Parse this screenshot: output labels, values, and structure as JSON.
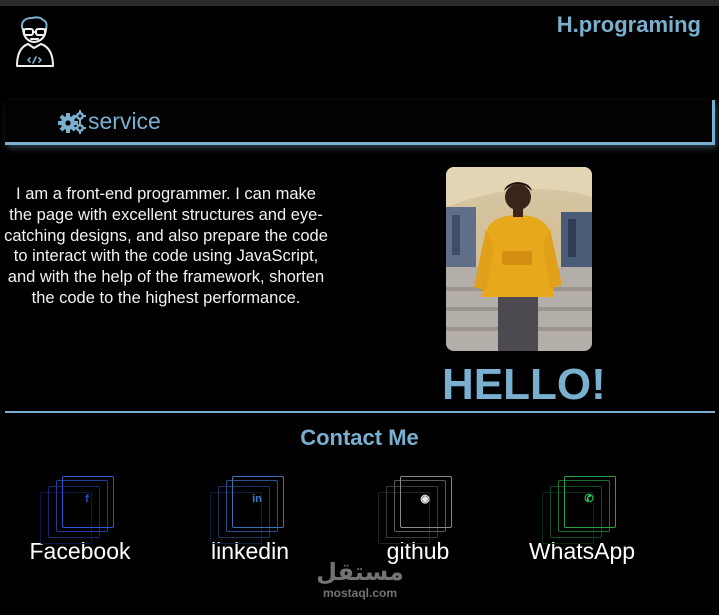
{
  "header": {
    "brand": "H.programing",
    "logo_icon": "programmer-avatar-icon"
  },
  "nav": {
    "items": [
      {
        "label": "service",
        "icon": "gears-icon"
      }
    ]
  },
  "about": {
    "text": "I am a front-end programmer. I can make the page with excellent structures and eye-catching designs, and also prepare the code to interact with the code using JavaScript, and with the help of the framework, shorten the code to the highest performance."
  },
  "hero": {
    "greeting": "HELLO!"
  },
  "contact": {
    "title": "Contact Me",
    "links": [
      {
        "label": "Facebook",
        "icon": "facebook-icon",
        "glyph": "f",
        "color": "#1f4fd8"
      },
      {
        "label": "linkedin",
        "icon": "linkedin-icon",
        "glyph": "in",
        "color": "#3a7fd0"
      },
      {
        "label": "github",
        "icon": "github-icon",
        "glyph": "◉",
        "color": "#e8e8e8"
      },
      {
        "label": "WhatsApp",
        "icon": "whatsapp-icon",
        "glyph": "✆",
        "color": "#25a244"
      }
    ]
  },
  "watermark": {
    "arabic": "مستقل",
    "latin": "mostaql.com"
  },
  "colors": {
    "accent": "#7ab0cf",
    "background": "#000000"
  }
}
